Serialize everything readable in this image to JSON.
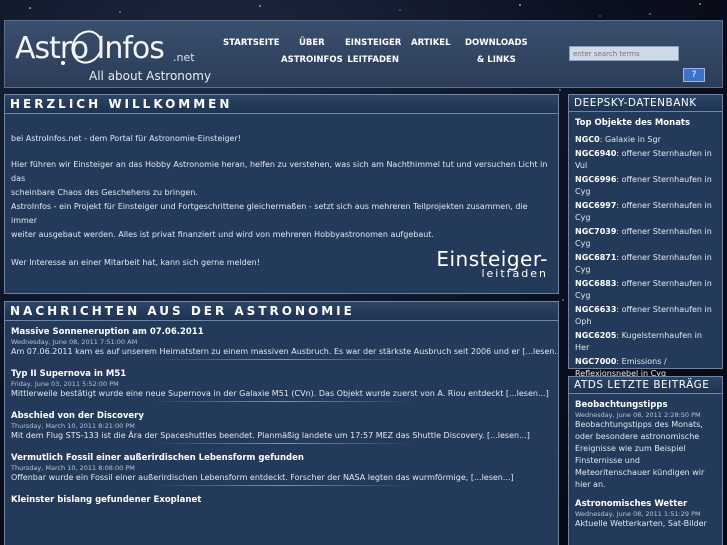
{
  "logo": {
    "main": "Astro Infos",
    "net": ".net",
    "tagline": "All about Astronomy"
  },
  "nav": [
    {
      "line1": "STARTSEITE",
      "line2": ""
    },
    {
      "line1": "ÜBER",
      "line2": "ASTROINFOS"
    },
    {
      "line1": "EINSTEIGER",
      "line2": "LEITFADEN"
    },
    {
      "line1": "ARTIKEL",
      "line2": ""
    },
    {
      "line1": "DOWNLOADS",
      "line2": "& LINKS"
    }
  ],
  "search": {
    "placeholder": "enter search terms",
    "button": "?"
  },
  "welcome": {
    "title": "HERZLICH WILLKOMMEN",
    "p1": "bei AstroInfos.net - dem Portal für Astronomie-Einsteiger!",
    "p2a": "Hier führen wir Einsteiger an das Hobby Astronomie heran, helfen zu verstehen, was sich am Nachthimmel tut und versuchen Licht in das",
    "p2b": "scheinbare Chaos des Geschehens zu bringen.",
    "p2c": "AstroInfos - ein Projekt für Einsteiger und Fortgeschrittene gleichermaßen - setzt sich aus mehreren Teilprojekten zusammen, die immer",
    "p2d": "weiter ausgebaut werden. Alles ist privat finanziert und wird von mehreren Hobbyastronomen aufgebaut.",
    "p3": "Wer Interesse an einer Mitarbeit hat, kann sich gerne melden!",
    "einsteiger_line1": "Einsteiger-",
    "einsteiger_line2": "leitfaden"
  },
  "news": {
    "title": "NACHRICHTEN AUS DER ASTRONOMIE",
    "items": [
      {
        "title": "Massive Sonneneruption am 07.06.2011",
        "date": "Wednesday, June 08, 2011 7:51:00 AM",
        "text": "Am 07.06.2011 kam es auf unserem Heimatstern zu einem massiven Ausbruch. Es war der stärkste Ausbruch seit 2006 und er [...lesen...]"
      },
      {
        "title": "Typ II Supernova in M51",
        "date": "Friday, June 03, 2011 5:52:00 PM",
        "text": "Mittlerweile bestätigt wurde eine neue Supernova in der Galaxie M51 (CVn). Das Objekt wurde zuerst von A. Riou entdeckt [...lesen...]"
      },
      {
        "title": "Abschied von der Discovery",
        "date": "Thursday, March 10, 2011 8:21:00 PM",
        "text": "Mit dem Flug STS-133 ist die Ära der Spaceshuttles beendet. Planmäßig landete um 17:57 MEZ das Shuttle Discovery. [...lesen...]"
      },
      {
        "title": "Vermutlich Fossil einer außerirdischen Lebensform gefunden",
        "date": "Thursday, March 10, 2011 8:08:00 PM",
        "text": "Offenbar wurde ein Fossil einer außerirdischen Lebensform entdeckt. Forscher der NASA legten das wurmförmige, [...lesen...]"
      },
      {
        "title": "Kleinster bislang gefundener Exoplanet",
        "date": "",
        "text": ""
      }
    ]
  },
  "deepsky": {
    "title": "DEEPSKY-DATENBANK",
    "subtitle": "Top Objekte des Monats",
    "items": [
      {
        "id": "NGC0",
        "desc": ": Galaxie in Sgr"
      },
      {
        "id": "NGC6940",
        "desc": ": offener Sternhaufen in Vul"
      },
      {
        "id": "NGC6996",
        "desc": ": offener Sternhaufen in Cyg"
      },
      {
        "id": "NGC6997",
        "desc": ": offener Sternhaufen in Cyg"
      },
      {
        "id": "NGC7039",
        "desc": ": offener Sternhaufen in Cyg"
      },
      {
        "id": "NGC6871",
        "desc": ": offener Sternhaufen in Cyg"
      },
      {
        "id": "NGC6883",
        "desc": ": offener Sternhaufen in Cyg"
      },
      {
        "id": "NGC6633",
        "desc": ": offener Sternhaufen in Oph"
      },
      {
        "id": "NGC6205",
        "desc": ": Kugelsternhaufen in Her"
      },
      {
        "id": "NGC7000",
        "desc": ": Emissions / Reflexionsnebel in Cyg"
      }
    ]
  },
  "atds": {
    "title": "ATDS LETZTE BEITRÄGE",
    "items": [
      {
        "title": "Beobachtungstipps",
        "date": "Wednesday, June 08, 2011 2:28:50 PM",
        "text": "Beobachtungstipps des Monats, oder besondere astronomische Ereignisse wie zum Beispiel Finsternisse und Meteoritenschauer kündigen wir hier an."
      },
      {
        "title": "Astronomisches Wetter",
        "date": "Wednesday, June 08, 2011 1:51:29 PM",
        "text": "Aktuelle Wetterkarten, Sat-Bilder"
      }
    ]
  }
}
